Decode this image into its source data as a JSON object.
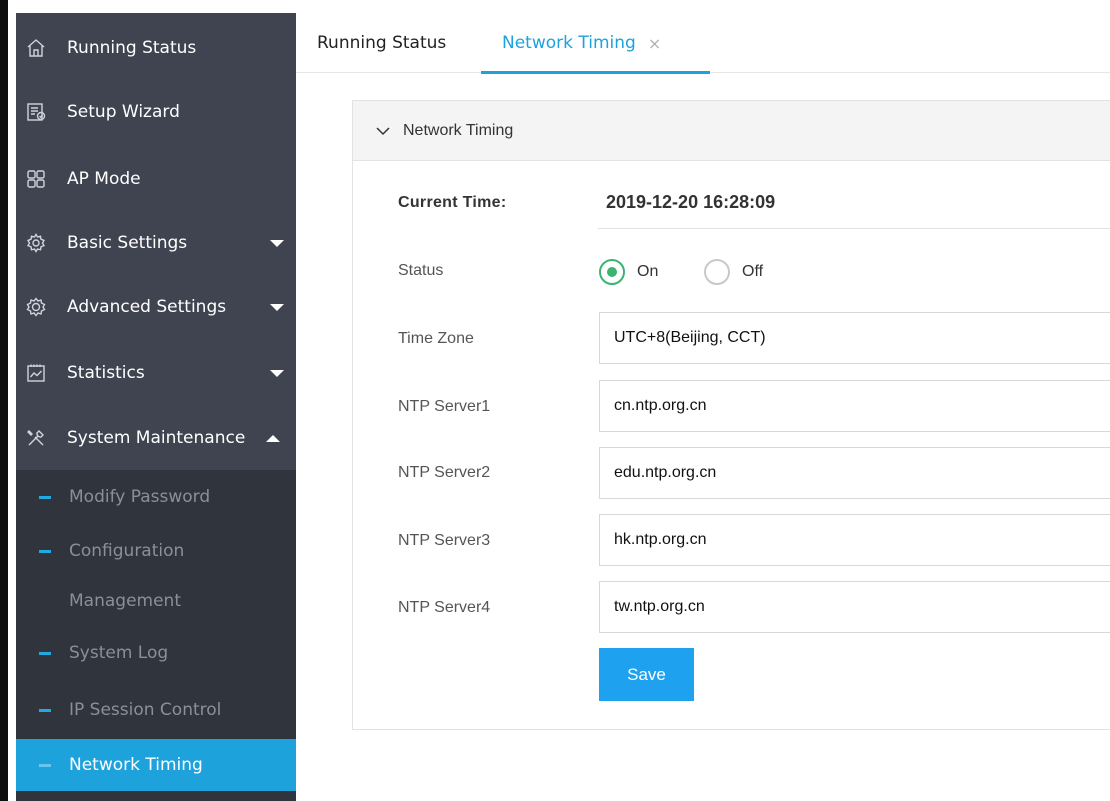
{
  "sidebar": {
    "items": [
      {
        "label": "Running Status",
        "icon": "home-icon"
      },
      {
        "label": "Setup Wizard",
        "icon": "wizard-icon"
      },
      {
        "label": "AP Mode",
        "icon": "grid-icon"
      },
      {
        "label": "Basic Settings",
        "icon": "gear-icon"
      },
      {
        "label": "Advanced Settings",
        "icon": "advanced-gear-icon"
      },
      {
        "label": "Statistics",
        "icon": "chart-icon"
      },
      {
        "label": "System Maintenance",
        "icon": "tools-icon"
      }
    ],
    "submenu": [
      {
        "label": "Modify Password"
      },
      {
        "label": "Configuration"
      },
      {
        "label": "Management"
      },
      {
        "label": "System Log"
      },
      {
        "label": "IP Session Control"
      },
      {
        "label": "Network Timing"
      }
    ]
  },
  "tabs": {
    "running": "Running Status",
    "network": "Network Timing",
    "close_glyph": "×"
  },
  "panel": {
    "title": "Network Timing",
    "current_time_label": "Current Time:",
    "current_time_value": "2019-12-20 16:28:09",
    "status_label": "Status",
    "status_on": "On",
    "status_off": "Off",
    "status_value": "On",
    "time_zone_label": "Time Zone",
    "time_zone_value": "UTC+8(Beijing, CCT)",
    "ntp1_label": "NTP Server1",
    "ntp1_value": "cn.ntp.org.cn",
    "ntp2_label": "NTP Server2",
    "ntp2_value": "edu.ntp.org.cn",
    "ntp3_label": "NTP Server3",
    "ntp3_value": "hk.ntp.org.cn",
    "ntp4_label": "NTP Server4",
    "ntp4_value": "tw.ntp.org.cn",
    "save_label": "Save"
  },
  "colors": {
    "sidebar_bg": "#3f4450",
    "submenu_bg": "#2f343d",
    "accent": "#1ea2dc",
    "radio_checked": "#3cb371",
    "save_button": "#1ea2f0"
  }
}
